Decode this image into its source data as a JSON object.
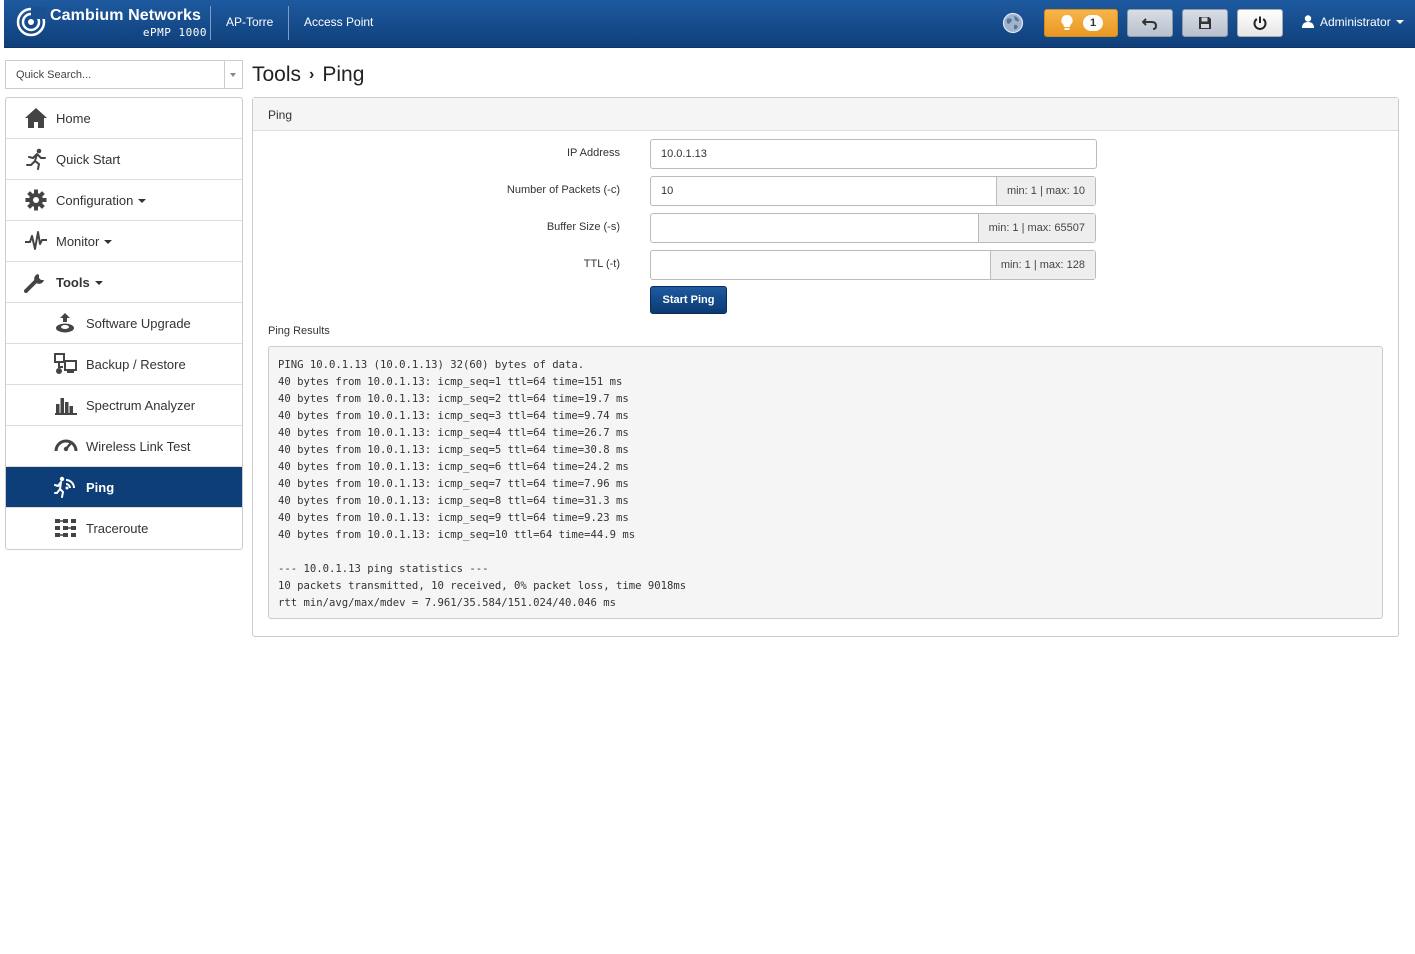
{
  "header": {
    "brand_name": "Cambium Networks",
    "brand_model": "ePMP 1000",
    "device_name": "AP-Torre",
    "device_mode": "Access Point",
    "alert_count": "1",
    "user_label": "Administrator"
  },
  "search": {
    "placeholder": "Quick Search..."
  },
  "sidebar": {
    "items": [
      {
        "label": "Home",
        "icon": "home-icon"
      },
      {
        "label": "Quick Start",
        "icon": "runner-icon"
      },
      {
        "label": "Configuration",
        "icon": "gear-icon"
      },
      {
        "label": "Monitor",
        "icon": "pulse-icon"
      },
      {
        "label": "Tools",
        "icon": "wrench-icon"
      }
    ],
    "subitems": [
      {
        "label": "Software Upgrade",
        "icon": "upgrade-icon"
      },
      {
        "label": "Backup / Restore",
        "icon": "backup-icon"
      },
      {
        "label": "Spectrum Analyzer",
        "icon": "spectrum-icon"
      },
      {
        "label": "Wireless Link Test",
        "icon": "gauge-icon"
      },
      {
        "label": "Ping",
        "icon": "ping-icon"
      },
      {
        "label": "Traceroute",
        "icon": "traceroute-icon"
      }
    ]
  },
  "breadcrumb": {
    "parent": "Tools",
    "current": "Ping"
  },
  "panel": {
    "title": "Ping"
  },
  "form": {
    "ip_label": "IP Address",
    "ip_value": "10.0.1.13",
    "packets_label": "Number of Packets (-c)",
    "packets_value": "10",
    "packets_hint": "min: 1 | max: 10",
    "buffer_label": "Buffer Size (-s)",
    "buffer_value": "",
    "buffer_hint": "min: 1 | max: 65507",
    "ttl_label": "TTL (-t)",
    "ttl_value": "",
    "ttl_hint": "min: 1 | max: 128",
    "start_label": "Start Ping"
  },
  "results": {
    "label": "Ping Results",
    "output": "PING 10.0.1.13 (10.0.1.13) 32(60) bytes of data.\n40 bytes from 10.0.1.13: icmp_seq=1 ttl=64 time=151 ms\n40 bytes from 10.0.1.13: icmp_seq=2 ttl=64 time=19.7 ms\n40 bytes from 10.0.1.13: icmp_seq=3 ttl=64 time=9.74 ms\n40 bytes from 10.0.1.13: icmp_seq=4 ttl=64 time=26.7 ms\n40 bytes from 10.0.1.13: icmp_seq=5 ttl=64 time=30.8 ms\n40 bytes from 10.0.1.13: icmp_seq=6 ttl=64 time=24.2 ms\n40 bytes from 10.0.1.13: icmp_seq=7 ttl=64 time=7.96 ms\n40 bytes from 10.0.1.13: icmp_seq=8 ttl=64 time=31.3 ms\n40 bytes from 10.0.1.13: icmp_seq=9 ttl=64 time=9.23 ms\n40 bytes from 10.0.1.13: icmp_seq=10 ttl=64 time=44.9 ms\n\n--- 10.0.1.13 ping statistics ---\n10 packets transmitted, 10 received, 0% packet loss, time 9018ms\nrtt min/avg/max/mdev = 7.961/35.584/151.024/40.046 ms"
  },
  "colors": {
    "header_blue": "#0f3f7a",
    "active_item": "#0d3e78",
    "alert_orange": "#f0a535"
  }
}
